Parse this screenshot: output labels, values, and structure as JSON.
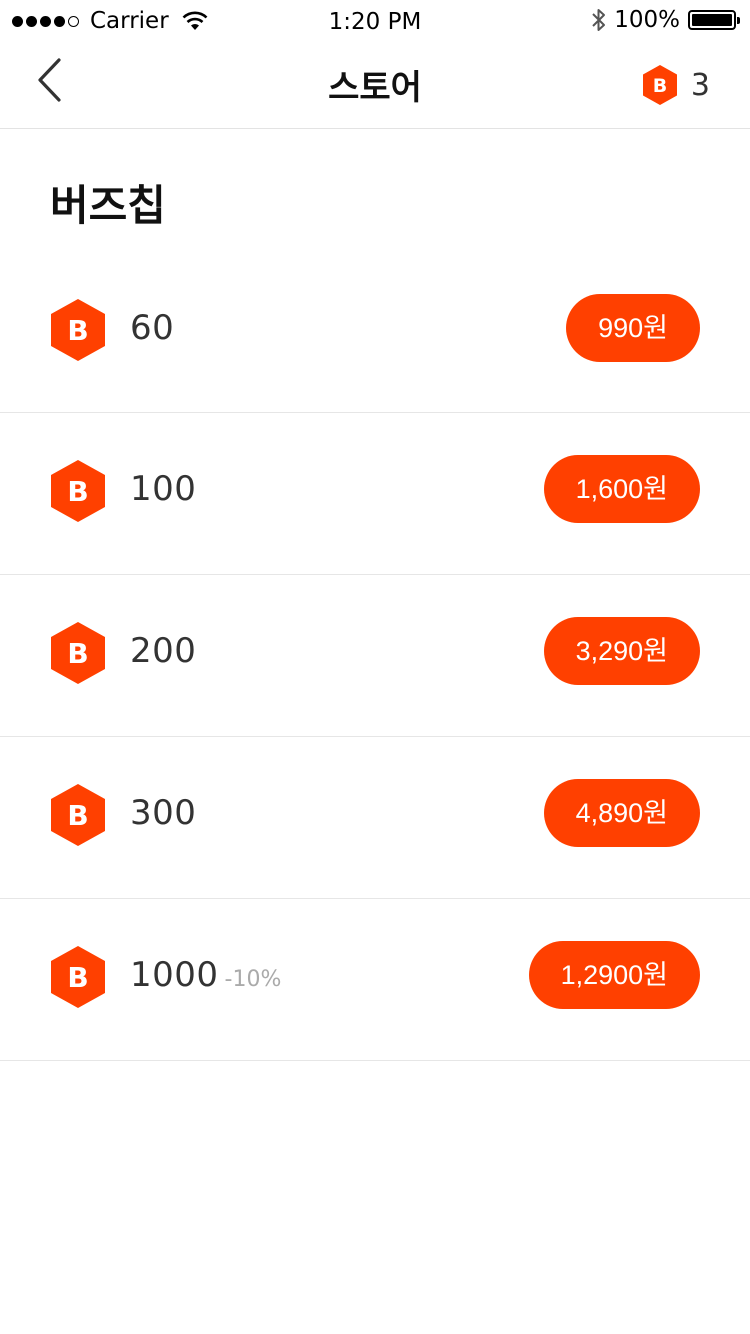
{
  "status_bar": {
    "carrier": "Carrier",
    "time": "1:20 PM",
    "battery": "100%"
  },
  "nav": {
    "title": "스토어",
    "balance_icon_letter": "B",
    "balance_count": "3"
  },
  "section": {
    "title": "버즈칩"
  },
  "products": [
    {
      "icon_letter": "B",
      "amount": "60",
      "discount": "",
      "price": "990원"
    },
    {
      "icon_letter": "B",
      "amount": "100",
      "discount": "",
      "price": "1,600원"
    },
    {
      "icon_letter": "B",
      "amount": "200",
      "discount": "",
      "price": "3,290원"
    },
    {
      "icon_letter": "B",
      "amount": "300",
      "discount": "",
      "price": "4,890원"
    },
    {
      "icon_letter": "B",
      "amount": "1000",
      "discount": "-10%",
      "price": "1,2900원"
    }
  ],
  "colors": {
    "accent": "#ff4000"
  },
  "icons": {
    "back": "chevron-left-icon",
    "chip": "b-hexagon-icon",
    "wifi": "wifi-icon",
    "bluetooth": "bluetooth-icon",
    "battery": "battery-icon"
  }
}
